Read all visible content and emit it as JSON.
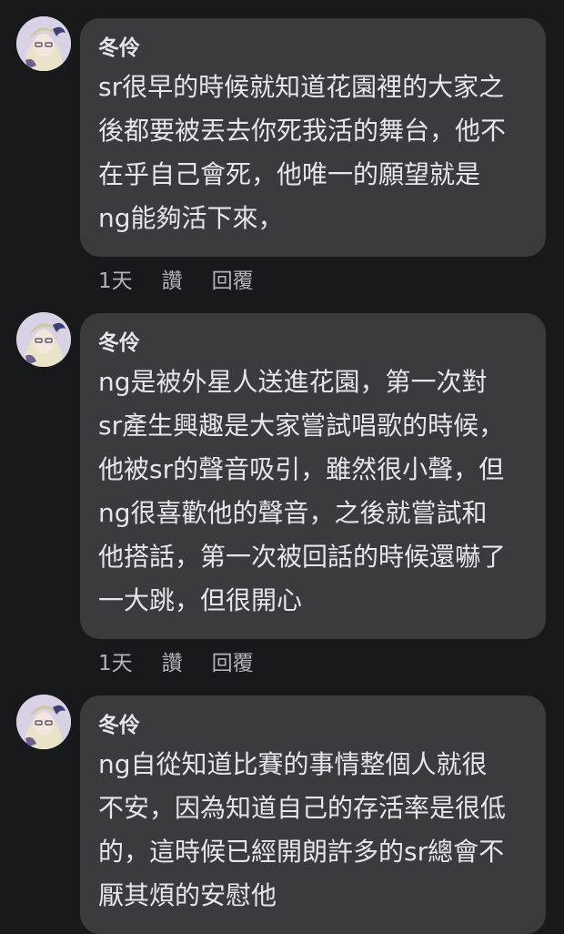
{
  "comments": [
    {
      "author": "冬伶",
      "lines": [
        "sr很早的時候就知道花園裡的大家之",
        "後都要被丟去你死我活的舞台，他不",
        "在乎自己會死，他唯一的願望就是",
        "ng能夠活下來，"
      ],
      "time": "1天",
      "like_label": "讚",
      "reply_label": "回覆"
    },
    {
      "author": "冬伶",
      "lines": [
        "ng是被外星人送進花園，第一次對",
        "sr產生興趣是大家嘗試唱歌的時候，",
        "他被sr的聲音吸引，雖然很小聲，但",
        "ng很喜歡他的聲音，之後就嘗試和",
        "他搭話，第一次被回話的時候還嚇了",
        "一大跳，但很開心"
      ],
      "time": "1天",
      "like_label": "讚",
      "reply_label": "回覆"
    },
    {
      "author": "冬伶",
      "lines": [
        "ng自從知道比賽的事情整個人就很",
        "不安，因為知道自己的存活率是很低",
        "的，這時候已經開朗許多的sr總會不",
        "厭其煩的安慰他"
      ]
    }
  ]
}
